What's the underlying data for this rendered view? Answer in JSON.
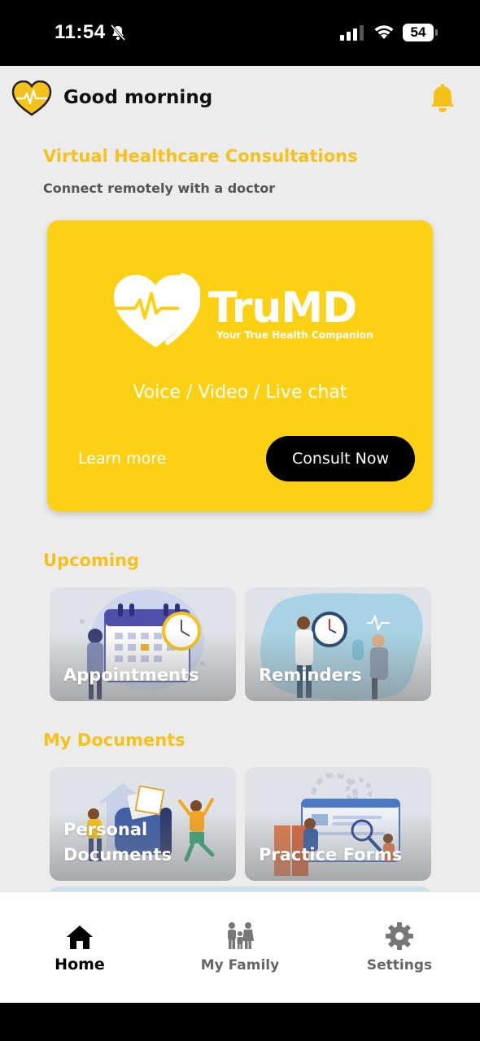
{
  "status_bar": {
    "time": "11:54",
    "battery": "54",
    "icons": [
      "mute-icon",
      "signal-icon",
      "wifi-icon",
      "battery-icon"
    ]
  },
  "header": {
    "greeting": "Good morning",
    "logo_icon": "heart-pulse-logo-icon",
    "notification_icon": "bell-icon"
  },
  "virtual": {
    "title": "Virtual Healthcare Consultations",
    "subtitle": "Connect remotely with a doctor"
  },
  "hero": {
    "brand_name": "TruMD",
    "tagline": "Your True Health Companion",
    "modes": "Voice / Video / Live chat",
    "learn_more": "Learn more",
    "consult_now": "Consult Now"
  },
  "upcoming": {
    "title": "Upcoming",
    "cards": [
      {
        "label": "Appointments"
      },
      {
        "label": "Reminders"
      }
    ]
  },
  "documents": {
    "title": "My Documents",
    "cards": [
      {
        "label_line1": "Personal",
        "label_line2": "Documents"
      },
      {
        "label": "Practice Forms"
      }
    ]
  },
  "tabs": [
    {
      "label": "Home",
      "icon": "home-icon",
      "active": true
    },
    {
      "label": "My Family",
      "icon": "family-icon",
      "active": false
    },
    {
      "label": "Settings",
      "icon": "gear-icon",
      "active": false
    }
  ],
  "colors": {
    "accent": "#f5c21b",
    "hero_bg": "#fcd114",
    "page_bg": "#ececec",
    "button_bg": "#000000"
  }
}
